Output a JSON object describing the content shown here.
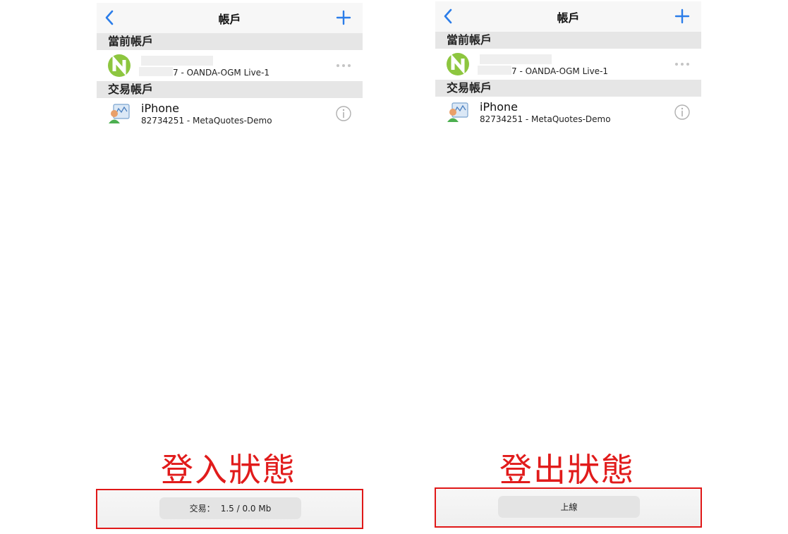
{
  "left_panel": {
    "nav_title": "帳戶",
    "current_section": "當前帳戶",
    "current_account_suffix": "7 - OANDA-OGM Live-1",
    "trading_section": "交易帳戶",
    "trading_account_name": "iPhone",
    "trading_account_detail": "82734251 - MetaQuotes-Demo",
    "state_label": "登入狀態",
    "status_prefix": "交易：",
    "status_value": "1.5 / 0.0 Mb"
  },
  "right_panel": {
    "nav_title": "帳戶",
    "current_section": "當前帳戶",
    "current_account_suffix": "7 - OANDA-OGM Live-1",
    "trading_section": "交易帳戶",
    "trading_account_name": "iPhone",
    "trading_account_detail": "82734251 - MetaQuotes-Demo",
    "state_label": "登出狀態",
    "button_label": "上線"
  },
  "colors": {
    "accent": "#2b7de9",
    "highlight": "#e01818",
    "oanda_green": "#8dc63f"
  },
  "icons": {
    "back": "chevron-left-icon",
    "add": "plus-icon",
    "more": "more-dots-icon",
    "info": "info-icon",
    "broker_logo": "oanda-logo-icon",
    "account_user": "user-account-icon"
  }
}
